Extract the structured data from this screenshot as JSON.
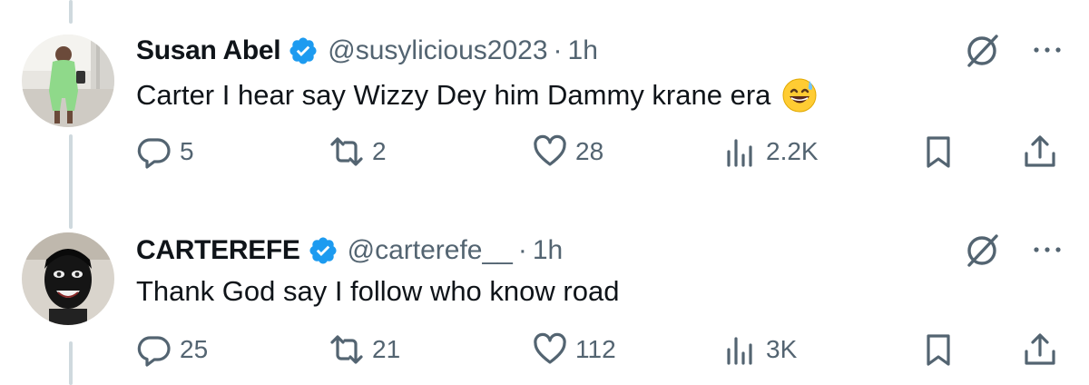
{
  "tweets": [
    {
      "name": "Susan Abel",
      "handle": "@susylicious2023",
      "separator": "·",
      "time": "1h",
      "text": "Carter I hear say Wizzy Dey him Dammy krane era",
      "emoji": "grinning-face-with-sweat",
      "replies": "5",
      "reposts": "2",
      "likes": "28",
      "views": "2.2K"
    },
    {
      "name": "CARTEREFE",
      "handle": "@carterefe__",
      "separator": "·",
      "time": "1h",
      "text": "Thank God say I follow who know road",
      "replies": "25",
      "reposts": "21",
      "likes": "112",
      "views": "3K"
    }
  ],
  "colors": {
    "verified": "#1d9bf0",
    "secondary_text": "#536471",
    "thread_line": "#cfd9de"
  },
  "icons": [
    "verified-badge-icon",
    "grok-icon",
    "more-icon",
    "reply-icon",
    "repost-icon",
    "like-icon",
    "views-icon",
    "bookmark-icon",
    "share-icon"
  ]
}
